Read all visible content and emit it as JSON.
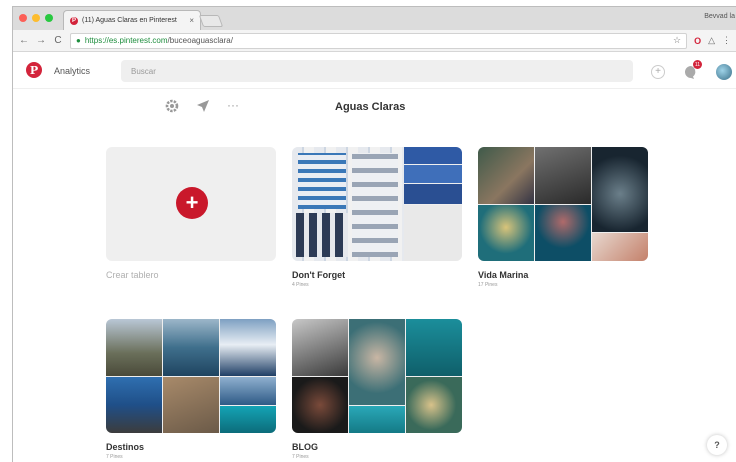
{
  "browser": {
    "tab_title": "(11) Aguas Claras en Pinterest",
    "tab_close": "×",
    "profile_name": "Bevvad la",
    "url_secure": "https://es.pinterest.com",
    "url_path": "/buceoaguasclara/",
    "nav_back": "←",
    "nav_forward": "→",
    "nav_reload": "C",
    "bookmark_star": "☆",
    "opera_ext": "O",
    "menu": "⋮"
  },
  "header": {
    "logo": "P",
    "analytics_label": "Analytics",
    "search_placeholder": "Buscar",
    "add_icon": "+",
    "notifications_count": "11"
  },
  "board_page": {
    "title": "Aguas Claras",
    "more_label": "···"
  },
  "boards": [
    {
      "name": "Crear tablero",
      "count": "",
      "plus": "+"
    },
    {
      "name": "Don't Forget",
      "count": "4 Pines"
    },
    {
      "name": "Vida Marina",
      "count": "17 Pines"
    },
    {
      "name": "Destinos",
      "count": "7 Pines"
    },
    {
      "name": "BLOG",
      "count": "7 Pines"
    }
  ],
  "help_label": "?",
  "colors": {
    "brand": "#d3243b",
    "create_button": "#c9182b"
  }
}
